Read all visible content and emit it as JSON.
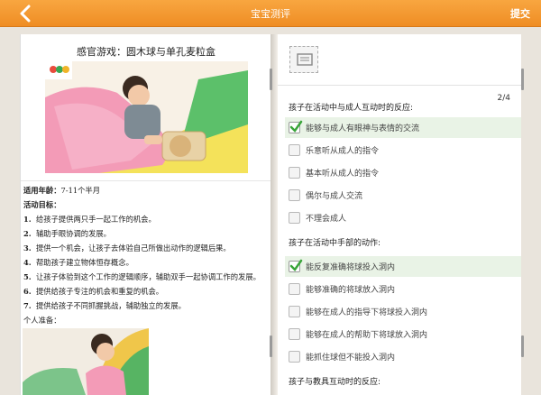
{
  "header": {
    "title": "宝宝测评",
    "submit_label": "提交",
    "accent": "#f39a30"
  },
  "left": {
    "game_title": "感官游戏：圆木球与单孔麦粒盒",
    "age_label": "适用年龄：",
    "age_value": "7-11个半月",
    "goal_label": "活动目标：",
    "goals": [
      {
        "num": "1.",
        "text": "给孩子提供两只手一起工作的机会。"
      },
      {
        "num": "2.",
        "text": "辅助手眼协调的发展。"
      },
      {
        "num": "3.",
        "text": "提供一个机会，让孩子去体验自己所做出动作的逻辑后果。"
      },
      {
        "num": "4.",
        "text": "帮助孩子建立物体恒存概念。"
      },
      {
        "num": "5.",
        "text": "让孩子体验到这个工作的逻辑顺序，辅助双手一起协调工作的发展。"
      },
      {
        "num": "6.",
        "text": "提供给孩子专注的机会和重复的机会。"
      },
      {
        "num": "7.",
        "text": "提供给孩子不同抓握挑战，辅助独立的发展。"
      }
    ],
    "prep_label": "个人准备："
  },
  "right": {
    "page": "2/4",
    "questions": [
      {
        "title": "孩子在活动中与成人互动时的反应:",
        "options": [
          {
            "label": "能够与成人有眼神与表情的交流",
            "checked": true
          },
          {
            "label": "乐意听从成人的指令",
            "checked": false
          },
          {
            "label": "基本听从成人的指令",
            "checked": false
          },
          {
            "label": "偶尔与成人交流",
            "checked": false
          },
          {
            "label": "不理会成人",
            "checked": false
          }
        ]
      },
      {
        "title": "孩子在活动中手部的动作:",
        "options": [
          {
            "label": "能反复准确将球投入洞内",
            "checked": true
          },
          {
            "label": "能够准确的将球放入洞内",
            "checked": false
          },
          {
            "label": "能够在成人的指导下将球投入洞内",
            "checked": false
          },
          {
            "label": "能够在成人的帮助下将球放入洞内",
            "checked": false
          },
          {
            "label": "能抓住球但不能投入洞内",
            "checked": false
          }
        ]
      },
      {
        "title": "孩子与教具互动时的反应:",
        "options": []
      }
    ]
  }
}
